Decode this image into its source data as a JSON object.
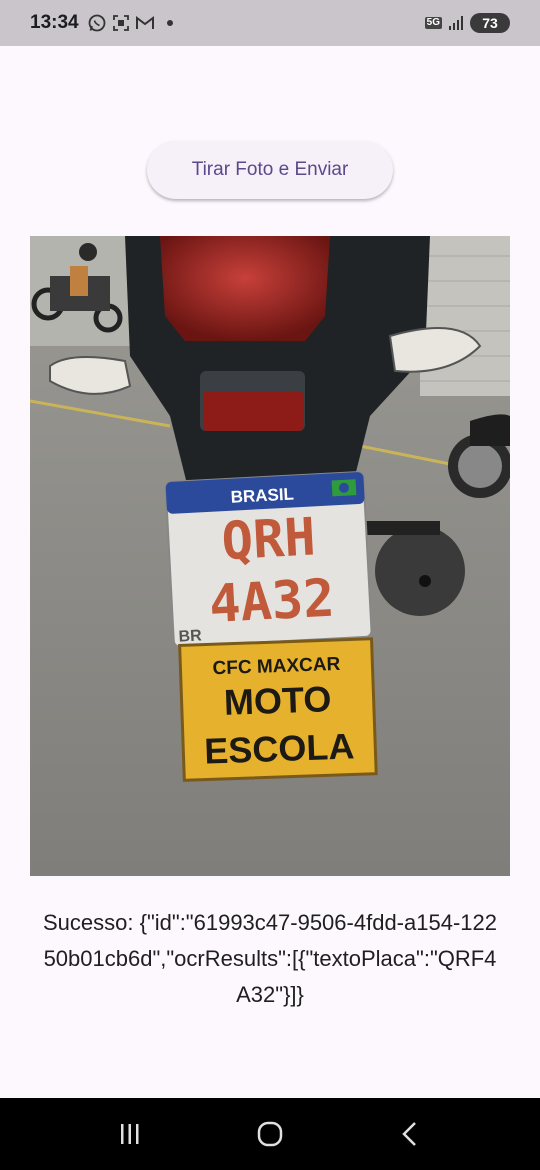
{
  "status_bar": {
    "time": "13:34",
    "notification_icons": [
      "whatsapp-icon",
      "screenshot-icon",
      "gmail-icon"
    ],
    "network": "5G",
    "battery": "73"
  },
  "main": {
    "send_button_label": "Tirar Foto e Enviar",
    "photo": {
      "plate_country": "BRASIL",
      "plate_text_line1": "QRH",
      "plate_text_line2": "4A32",
      "plate_br": "BR",
      "sign_line1": "CFC MAXCAR",
      "sign_line2": "MOTO",
      "sign_line3": "ESCOLA"
    },
    "result_text": "Sucesso: {\"id\":\"61993c47-9506-4fdd-a154-12250b01cb6d\",\"ocrResults\":[{\"textoPlaca\":\"QRF4A32\"}]}"
  },
  "nav_bar": {
    "icons": [
      "recents-icon",
      "home-icon",
      "back-icon"
    ]
  },
  "colors": {
    "background": "#fdf7fe",
    "button_text": "#5a4a8a",
    "status_bar": "#c9c5cb"
  }
}
